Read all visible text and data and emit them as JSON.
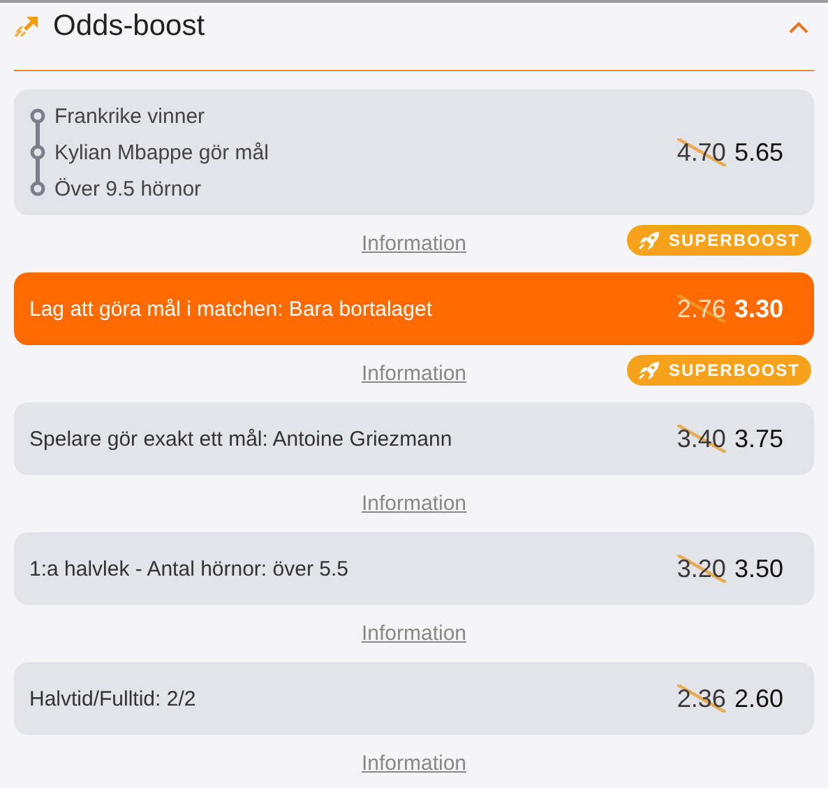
{
  "header": {
    "title": "Odds-boost",
    "expanded": true
  },
  "items": [
    {
      "kind": "multi",
      "selected": false,
      "legs": [
        "Frankrike vinner",
        "Kylian Mbappe gör mål",
        "Över 9.5 hörnor"
      ],
      "old_odds": "4.70",
      "odds": "5.65",
      "info": "Information",
      "badge": "SUPERBOOST"
    },
    {
      "kind": "single",
      "selected": true,
      "label": "Lag att göra mål i matchen: Bara bortalaget",
      "old_odds": "2.76",
      "odds": "3.30",
      "info": "Information",
      "badge": "SUPERBOOST"
    },
    {
      "kind": "single",
      "selected": false,
      "label": "Spelare gör exakt ett mål: Antoine Griezmann",
      "old_odds": "3.40",
      "odds": "3.75",
      "info": "Information"
    },
    {
      "kind": "single",
      "selected": false,
      "label": "1:a halvlek - Antal hörnor: över 5.5",
      "old_odds": "3.20",
      "odds": "3.50",
      "info": "Information"
    },
    {
      "kind": "single",
      "selected": false,
      "label": "Halvtid/Fulltid: 2/2",
      "old_odds": "2.36",
      "odds": "2.60",
      "info": "Information"
    }
  ]
}
